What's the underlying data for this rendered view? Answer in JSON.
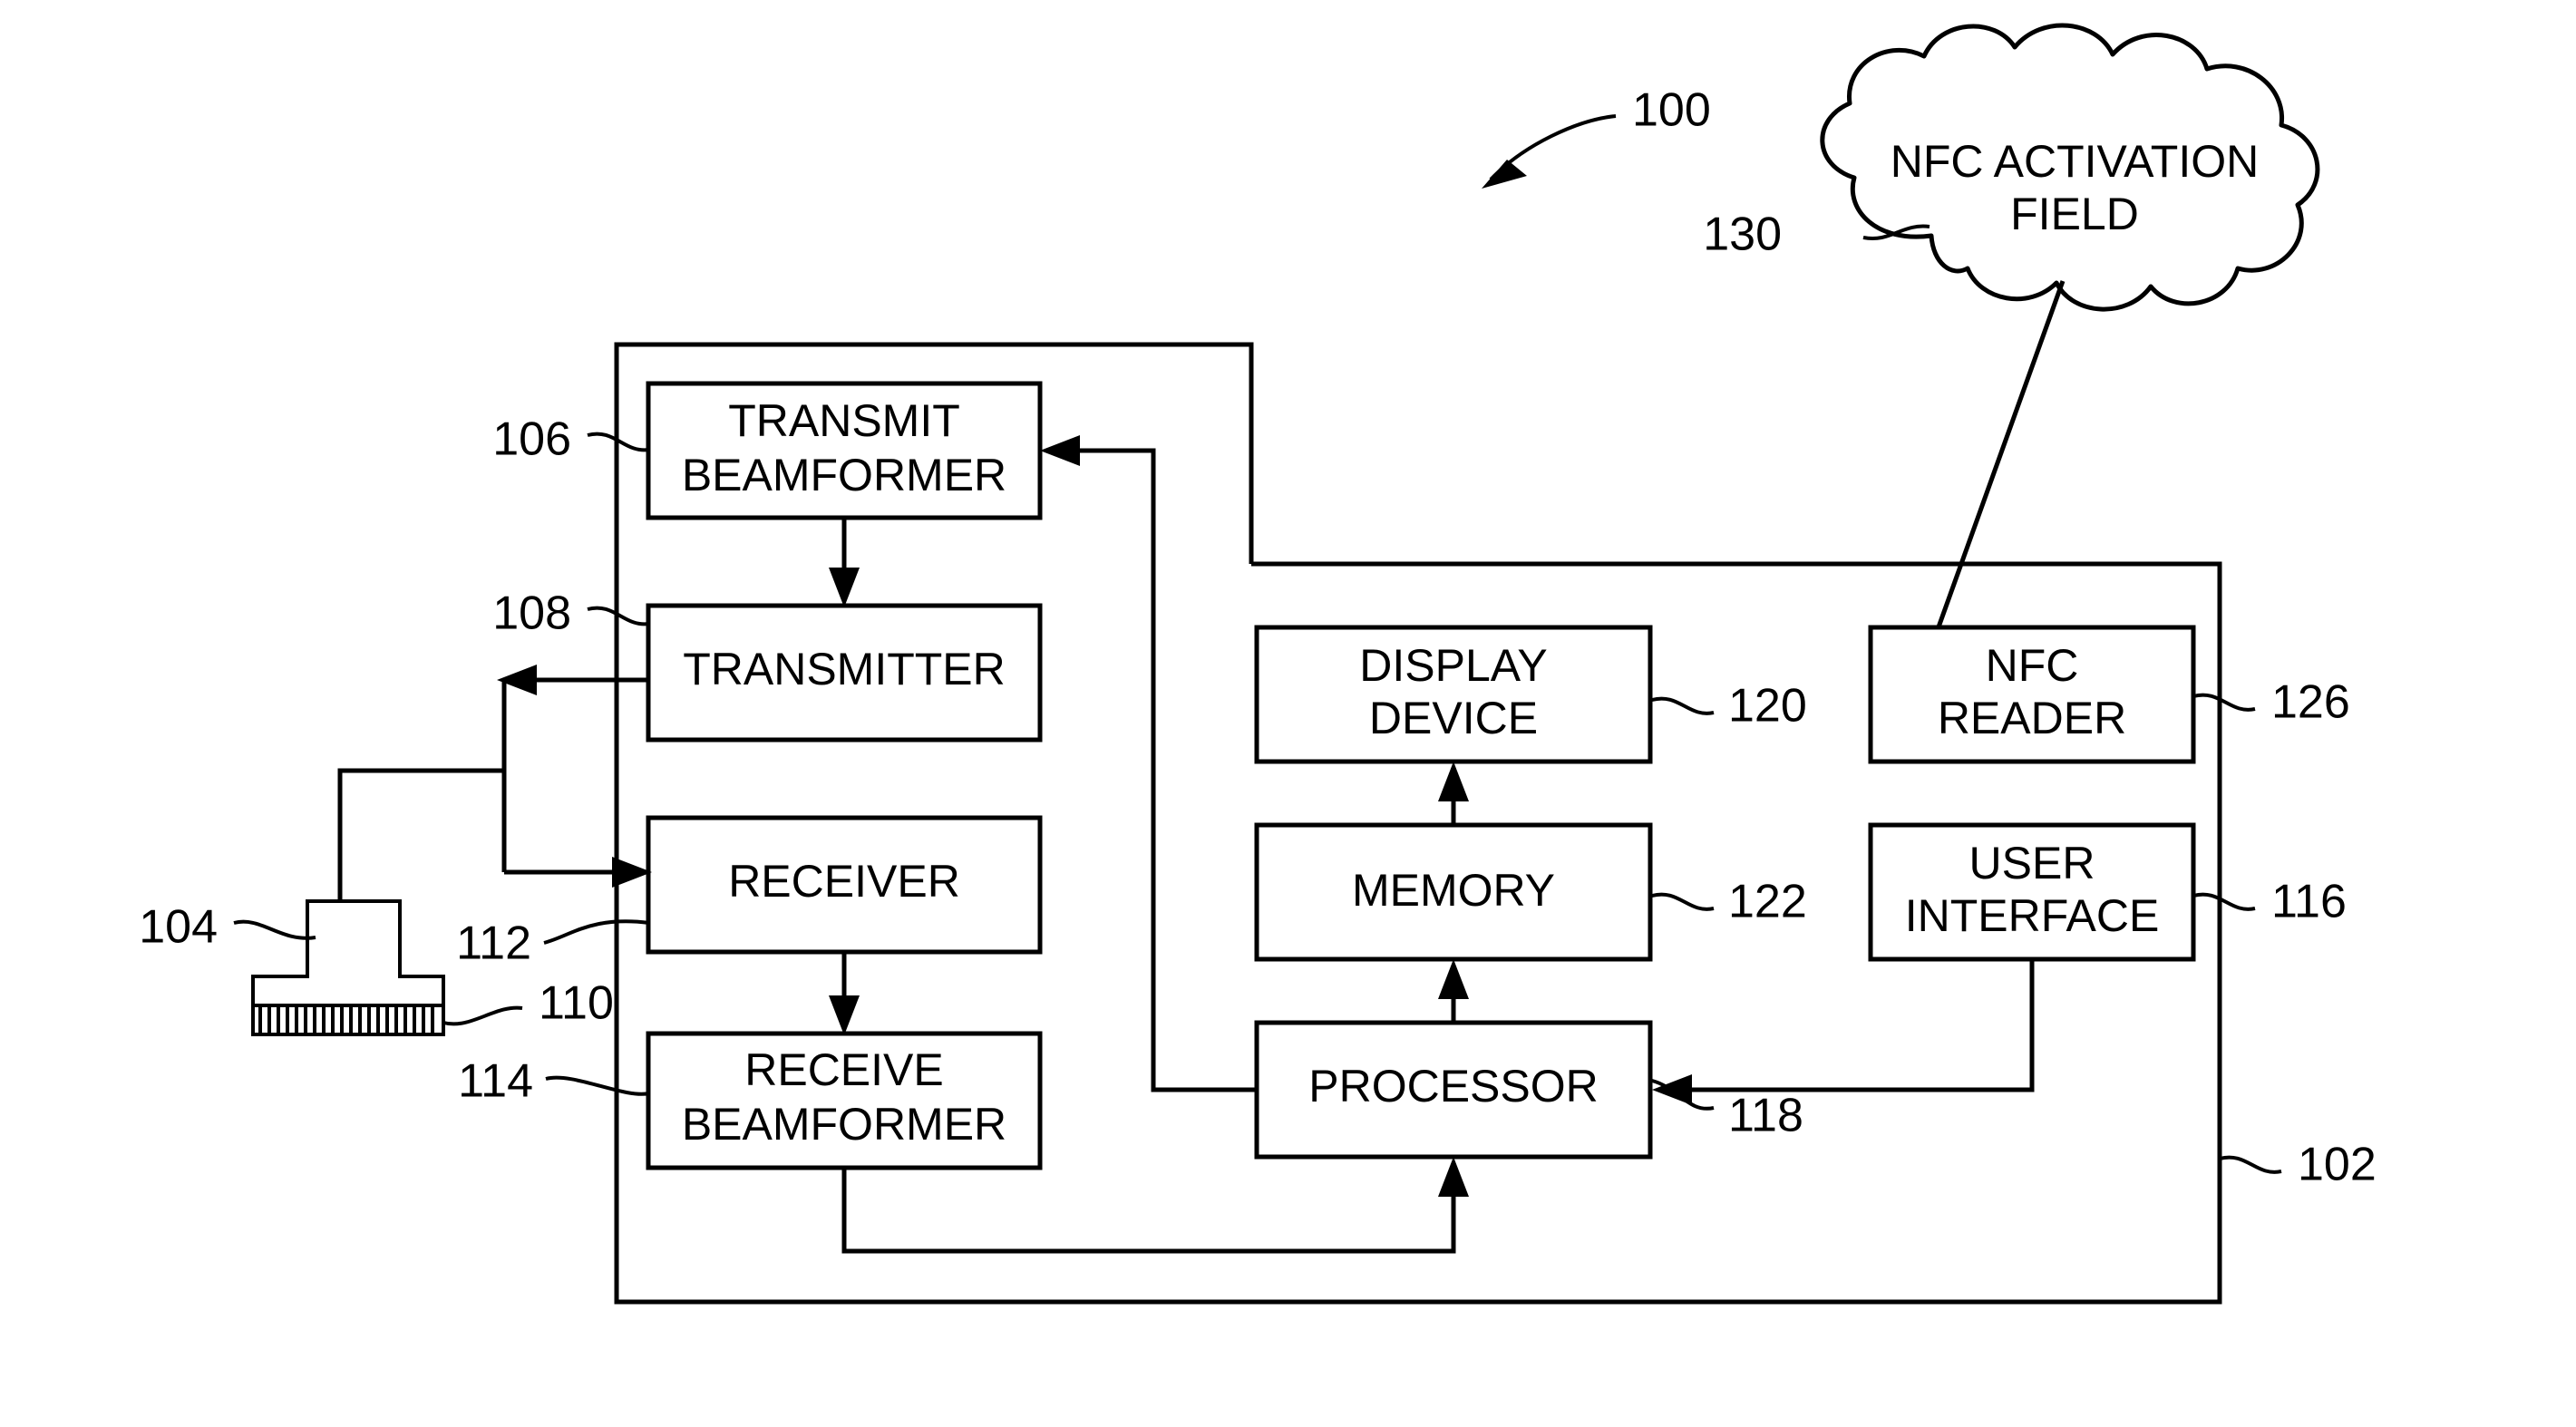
{
  "figure": {
    "title_ref": "100",
    "type": "patent-block-diagram",
    "system_ref": "102"
  },
  "cloud": {
    "line1": "NFC ACTIVATION",
    "line2": "FIELD",
    "ref": "130"
  },
  "blocks": [
    {
      "id": "transmit-beamformer",
      "line1": "TRANSMIT",
      "line2": "BEAMFORMER",
      "ref": "106"
    },
    {
      "id": "transmitter",
      "line1": "TRANSMITTER",
      "line2": "",
      "ref": "108"
    },
    {
      "id": "receiver",
      "line1": "RECEIVER",
      "line2": "",
      "ref": "112"
    },
    {
      "id": "receive-beamformer",
      "line1": "RECEIVE",
      "line2": "BEAMFORMER",
      "ref": "114"
    },
    {
      "id": "display-device",
      "line1": "DISPLAY",
      "line2": "DEVICE",
      "ref": "120"
    },
    {
      "id": "memory",
      "line1": "MEMORY",
      "line2": "",
      "ref": "122"
    },
    {
      "id": "processor",
      "line1": "PROCESSOR",
      "line2": "",
      "ref": "118"
    },
    {
      "id": "nfc-reader",
      "line1": "NFC",
      "line2": "READER",
      "ref": "126"
    },
    {
      "id": "user-interface",
      "line1": "USER",
      "line2": "INTERFACE",
      "ref": "116"
    }
  ],
  "probe": {
    "ref": "104",
    "array_ref": "110"
  },
  "refs": {
    "r100": "100",
    "r102": "102",
    "r104": "104",
    "r106": "106",
    "r108": "108",
    "r110": "110",
    "r112": "112",
    "r114": "114",
    "r116": "116",
    "r118": "118",
    "r120": "120",
    "r122": "122",
    "r126": "126",
    "r130": "130"
  },
  "colors": {
    "ink": "#000000",
    "paper": "#ffffff"
  }
}
